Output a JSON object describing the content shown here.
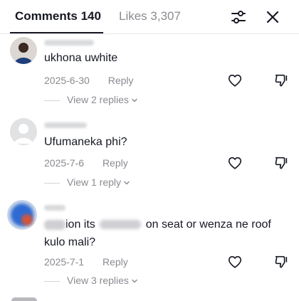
{
  "tabs": {
    "comments_label": "Comments 140",
    "likes_label": "Likes 3,307"
  },
  "icons": {
    "filter": "filter-sliders-icon",
    "close": "close-icon",
    "like": "heart-outline-icon",
    "dislike": "thumbs-down-outline-icon",
    "chevron": "chevron-down-icon"
  },
  "colors": {
    "text_primary": "#161823",
    "text_secondary": "#8a8b91",
    "divider": "#e8e8ea"
  },
  "comments": [
    {
      "text": "ukhona uwhite",
      "date": "2025-6-30",
      "reply_label": "Reply",
      "replies_label": "View 2 replies"
    },
    {
      "text": "Ufumaneka phi?",
      "date": "2025-7-6",
      "reply_label": "Reply",
      "replies_label": "View 1 reply"
    },
    {
      "text_part1": "ion its",
      "text_part2": "on seat or wenza ne roof",
      "text_part3": "kulo mali?",
      "date": "2025-7-1",
      "reply_label": "Reply",
      "replies_label": "View 3 replies"
    }
  ]
}
